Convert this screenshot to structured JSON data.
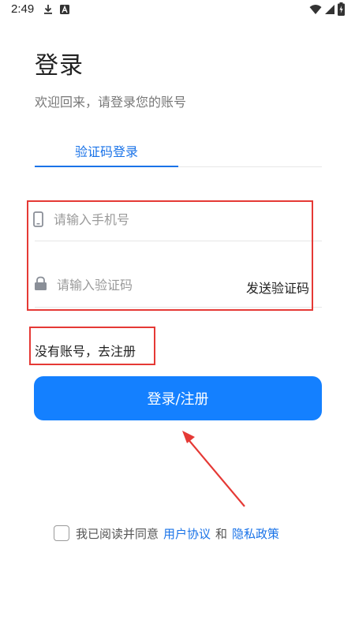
{
  "status_bar": {
    "time": "2:49",
    "icons": [
      "download-icon",
      "a-badge-icon",
      "wifi-icon",
      "signal-icon",
      "battery-charging-icon"
    ]
  },
  "header": {
    "title": "登录",
    "subtitle": "欢迎回来，请登录您的账号"
  },
  "tabs": [
    {
      "label": "验证码登录",
      "active": true
    }
  ],
  "form": {
    "phone_placeholder": "请输入手机号",
    "code_placeholder": "请输入验证码",
    "send_code_label": "发送验证码"
  },
  "register_link": "没有账号，去注册",
  "login_button": "登录/注册",
  "agreement": {
    "prefix": "我已阅读并同意",
    "user_agreement": "用户协议",
    "and": "和",
    "privacy_policy": "隐私政策"
  },
  "colors": {
    "accent": "#1480ff",
    "link": "#1a73e8",
    "annotation": "#e53935"
  }
}
